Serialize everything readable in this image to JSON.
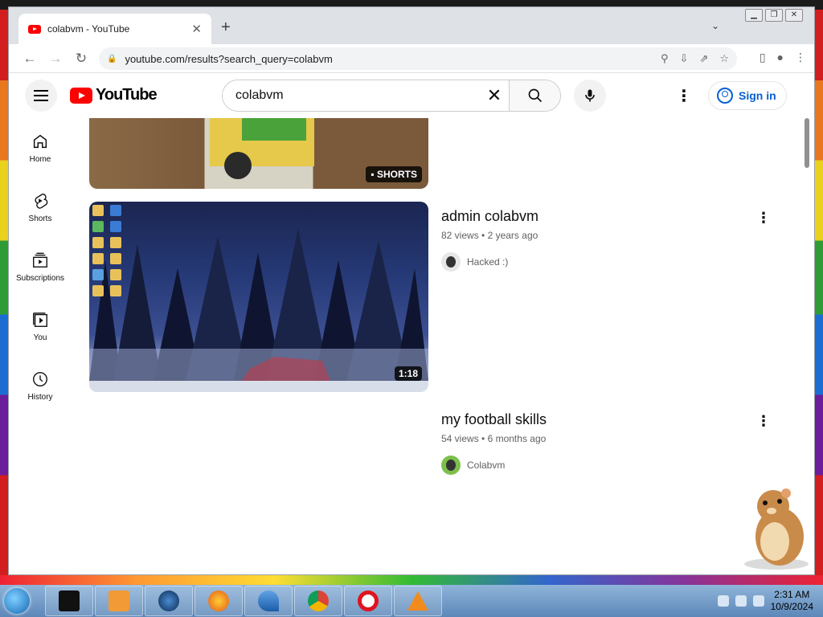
{
  "browser": {
    "tab_title": "colabvm - YouTube",
    "tab_close": "✕",
    "new_tab": "+",
    "url": "youtube.com/results?search_query=colabvm"
  },
  "youtube": {
    "logo_text": "YouTube",
    "search_value": "colabvm",
    "sign_in": "Sign in"
  },
  "sidebar": {
    "items": [
      {
        "label": "Home",
        "icon": "home-icon"
      },
      {
        "label": "Shorts",
        "icon": "shorts-icon"
      },
      {
        "label": "Subscriptions",
        "icon": "subscriptions-icon"
      },
      {
        "label": "You",
        "icon": "you-icon"
      },
      {
        "label": "History",
        "icon": "history-icon"
      }
    ]
  },
  "results": {
    "shorts_badge": "SHORTS",
    "videos": [
      {
        "title": "admin colabvm",
        "views": "82 views",
        "age": "2 years ago",
        "channel": "Hacked :)",
        "duration": "1:18"
      },
      {
        "title": "my football skills",
        "views": "54 views",
        "age": "6 months ago",
        "channel": "Colabvm"
      }
    ],
    "meta_sep": "•"
  },
  "taskbar": {
    "time": "2:31 AM",
    "date": "10/9/2024"
  },
  "colors": {
    "yt_red": "#ff0000",
    "link_blue": "#065fd4",
    "taskbar": "#5c87b8"
  }
}
